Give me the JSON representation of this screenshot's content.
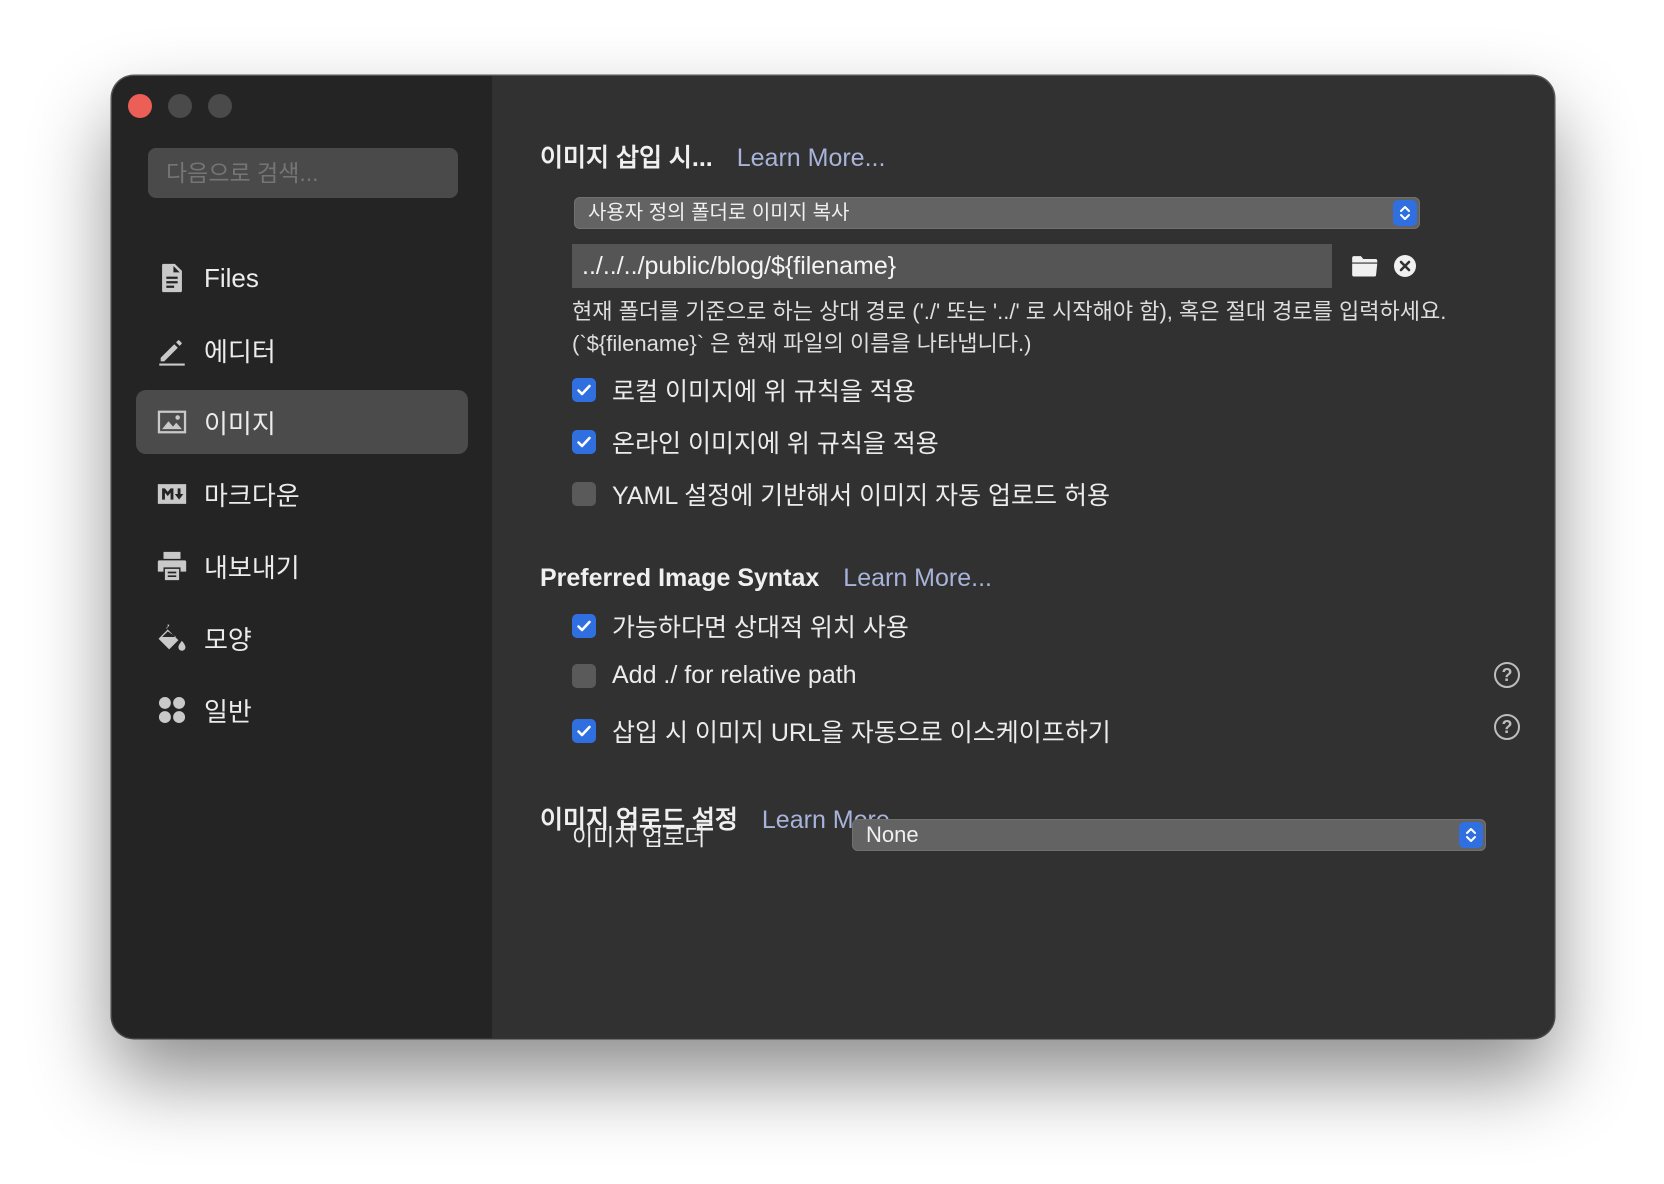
{
  "window": {
    "traffic_lights": [
      "close",
      "minimize",
      "maximize"
    ]
  },
  "sidebar": {
    "search_placeholder": "다음으로 검색...",
    "items": [
      {
        "label": "Files",
        "icon": "document-icon",
        "active": false
      },
      {
        "label": "에디터",
        "icon": "pencil-icon",
        "active": false
      },
      {
        "label": "이미지",
        "icon": "image-icon",
        "active": true
      },
      {
        "label": "마크다운",
        "icon": "markdown-icon",
        "active": false
      },
      {
        "label": "내보내기",
        "icon": "printer-icon",
        "active": false
      },
      {
        "label": "모양",
        "icon": "paint-bucket-icon",
        "active": false
      },
      {
        "label": "일반",
        "icon": "grid-icon",
        "active": false
      }
    ]
  },
  "insert_section": {
    "title": "이미지 삽입 시...",
    "learn_more": "Learn More...",
    "action_select": "사용자 정의 폴더로 이미지 복사",
    "path_value": "../../../public/blog/${filename}",
    "hint": "현재 폴더를 기준으로 하는 상대 경로 ('./' 또는 '../' 로 시작해야 함), 혹은 절대 경로를 입력하세요. (`${filename}` 은 현재 파일의 이름을 나타냅니다.)",
    "options": [
      {
        "label": "로컬 이미지에 위 규칙을 적용",
        "checked": true
      },
      {
        "label": "온라인 이미지에 위 규칙을 적용",
        "checked": true
      },
      {
        "label": "YAML 설정에 기반해서 이미지 자동 업로드 허용",
        "checked": false
      }
    ]
  },
  "syntax_section": {
    "title": "Preferred Image Syntax",
    "learn_more": "Learn More...",
    "options": [
      {
        "label": "가능하다면 상대적 위치 사용",
        "checked": true,
        "help": false
      },
      {
        "label": "Add ./ for relative path",
        "checked": false,
        "help": true
      },
      {
        "label": "삽입 시 이미지 URL을 자동으로 이스케이프하기",
        "checked": true,
        "help": true
      }
    ],
    "help_glyph": "?"
  },
  "upload_section": {
    "title": "이미지 업로드 설정",
    "learn_more": "Learn More...",
    "uploader_label": "이미지 업로더",
    "uploader_value": "None"
  },
  "colors": {
    "accent": "#2f6fe0",
    "link": "#a8b3d9",
    "close": "#ec5f57"
  }
}
